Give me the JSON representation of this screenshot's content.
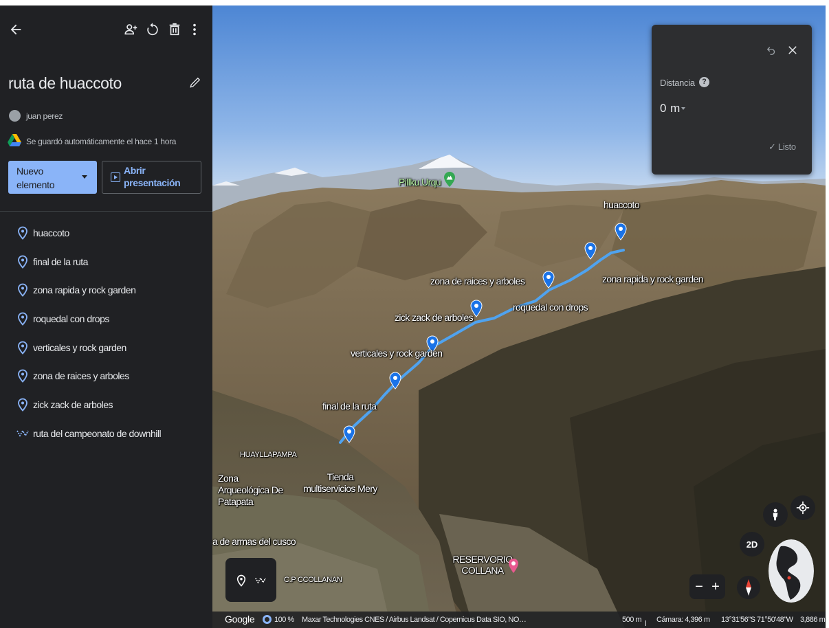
{
  "sidebar": {
    "title": "ruta de huaccoto",
    "author": "juan perez",
    "saved_status": "Se guardó automáticamente el hace 1 hora",
    "new_item_button": "Nuevo elemento",
    "presentation_button": "Abrir presentación",
    "toolbar_icons": [
      "back-arrow-icon",
      "share-person-icon",
      "sync-icon",
      "trash-icon",
      "more-vert-icon"
    ],
    "items": [
      {
        "label": "huaccoto",
        "icon": "placemark-icon"
      },
      {
        "label": "final de la ruta",
        "icon": "placemark-icon"
      },
      {
        "label": "zona rapida y rock garden",
        "icon": "placemark-icon"
      },
      {
        "label": "roquedal con drops",
        "icon": "placemark-icon"
      },
      {
        "label": "verticales y rock garden",
        "icon": "placemark-icon"
      },
      {
        "label": "zona de raices y arboles",
        "icon": "placemark-icon"
      },
      {
        "label": "zick zack de arboles",
        "icon": "placemark-icon"
      },
      {
        "label": "ruta del campeonato de downhill",
        "icon": "path-icon"
      }
    ]
  },
  "map": {
    "peak_label": "Pillku Urqu",
    "placemark_labels": {
      "huaccoto": "huaccoto",
      "zona_rapida": "zona rapida y rock garden",
      "zona_raices": "zona de raices y arboles",
      "roquedal": "roquedal con drops",
      "zick_zack": "zick zack de arboles",
      "verticales": "verticales y rock garden",
      "final": "final de la ruta"
    },
    "place_labels": {
      "huayllapampa": "HUAYLLAPAMPA",
      "arqueologica": "Zona Arqueológica De Patapata",
      "tienda": "Tienda multiservicios Mery",
      "plaza": "a de armas del cusco",
      "ccollanan": "C.P CCOLLANAN",
      "reservorio": "RESERVORIO COLLANA"
    },
    "measure_panel": {
      "label": "Distancia",
      "help": "?",
      "value": "0 m",
      "done": "Listo"
    },
    "controls": {
      "view_2d": "2D",
      "zoom_minus": "−",
      "zoom_plus": "+"
    },
    "bottom_bar": {
      "google": "Google",
      "load_percent": "100 %",
      "attribution": "Maxar Technologies CNES / Airbus Landsat / Copernicus Data SIO, NO…",
      "scale": "500 m",
      "camera": "Cámara: 4,396 m",
      "coords": "13°31'56\"S 71°50'48\"W",
      "elevation": "3,886 m"
    },
    "colors": {
      "route": "#4fa3f0",
      "pin": "#1a73e8",
      "panel_bg": "#2d2e30",
      "sidebar_bg": "#202124",
      "accent": "#8ab4f8"
    }
  }
}
